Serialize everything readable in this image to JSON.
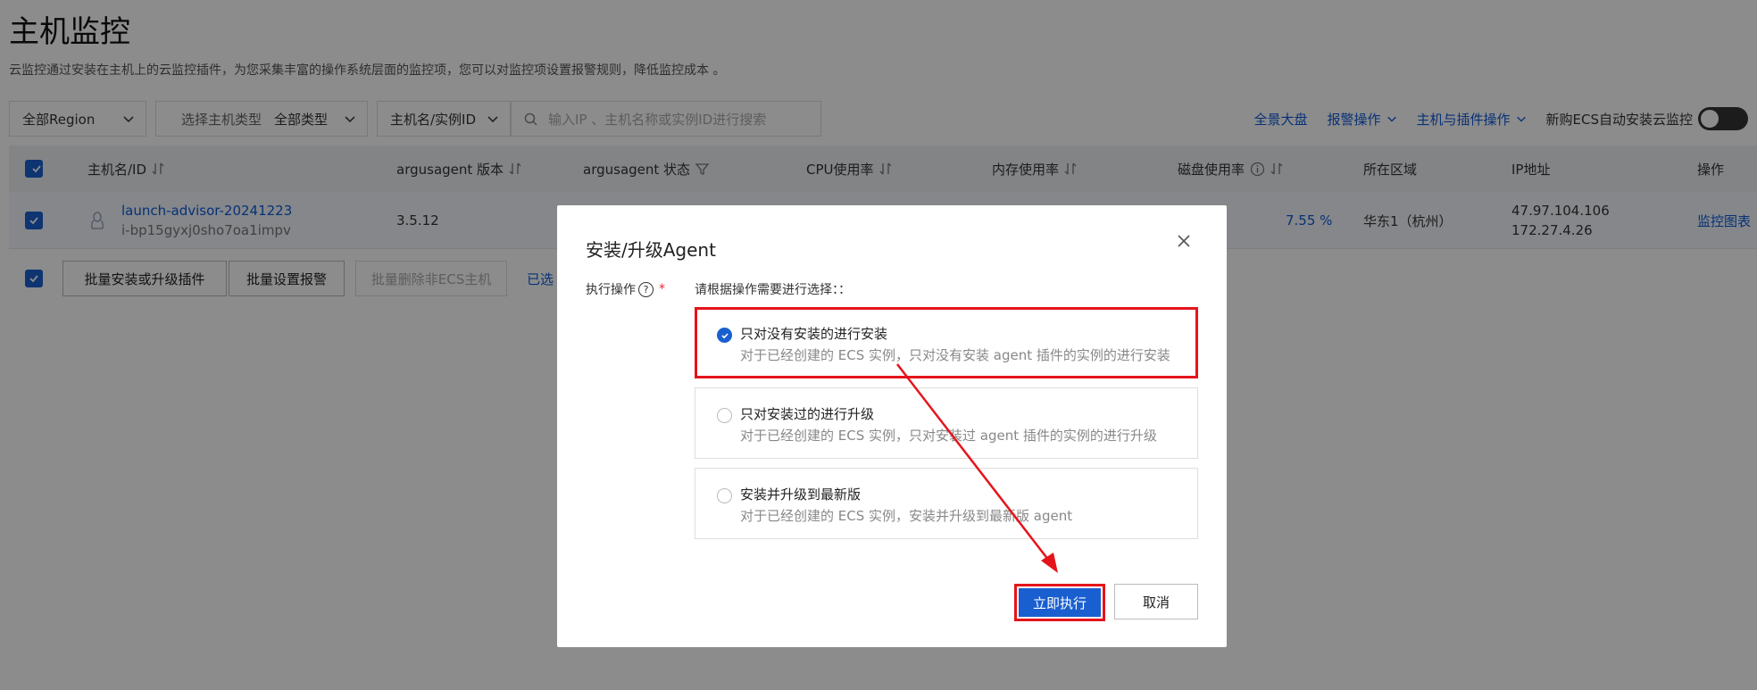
{
  "page": {
    "title": "主机监控",
    "description": "云监控通过安装在主机上的云监控插件，为您采集丰富的操作系统层面的监控项，您可以对监控项设置报警规则，降低监控成本 。"
  },
  "toolbar": {
    "region": "全部Region",
    "host_type_label": "选择主机类型",
    "host_type_value": "全部类型",
    "search_field": "主机名/实例ID",
    "search_placeholder": "输入IP 、主机名称或实例ID进行搜索",
    "dashboard_link": "全景大盘",
    "alarm_ops": "报警操作",
    "host_plugin_ops": "主机与插件操作",
    "auto_install_label": "新购ECS自动安装云监控"
  },
  "table": {
    "headers": [
      "主机名/ID",
      "argusagent 版本",
      "argusagent 状态",
      "CPU使用率",
      "内存使用率",
      "磁盘使用率",
      "所在区域",
      "IP地址",
      "操作"
    ],
    "row": {
      "host_name": "launch-advisor-20241223",
      "host_id": "i-bp15gyxj0sho7oa1impv",
      "version": "3.5.12",
      "disk_usage": "7.55 %",
      "region": "华东1（杭州）",
      "ip_public": "47.97.104.106",
      "ip_private": "172.27.4.26",
      "action": "监控图表"
    }
  },
  "batch": {
    "install_upgrade": "批量安装或升级插件",
    "set_alarm": "批量设置报警",
    "delete_non_ecs": "批量删除非ECS主机",
    "selected_prefix": "已选"
  },
  "dialog": {
    "title": "安装/升级Agent",
    "field_label": "执行操作",
    "hint": "请根据操作需要进行选择：：",
    "options": [
      {
        "title": "只对没有安装的进行安装",
        "desc": "对于已经创建的 ECS 实例，只对没有安装 agent 插件的实例的进行安装"
      },
      {
        "title": "只对安装过的进行升级",
        "desc": "对于已经创建的 ECS 实例，只对安装过 agent 插件的实例的进行升级"
      },
      {
        "title": "安装并升级到最新版",
        "desc": "对于已经创建的 ECS 实例，安装并升级到最新版 agent"
      }
    ],
    "execute_label": "立即执行",
    "cancel_label": "取消"
  },
  "colors": {
    "primary": "#1a5fd0",
    "highlight": "#e5141b",
    "link": "#0d5ad8"
  }
}
